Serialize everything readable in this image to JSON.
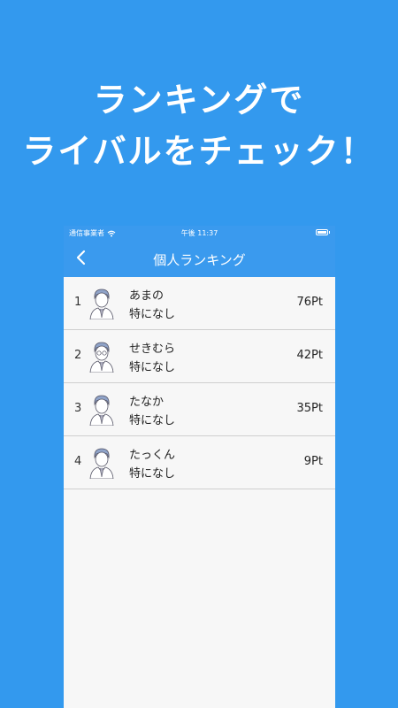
{
  "promo": {
    "line1": "ランキングで",
    "line2": "ライバルをチェック！"
  },
  "statusbar": {
    "carrier": "通信事業者",
    "time": "午後 11:37"
  },
  "navbar": {
    "title": "個人ランキング"
  },
  "rankings": [
    {
      "rank": "1",
      "name": "あまの",
      "status": "特になし",
      "points": "76Pt"
    },
    {
      "rank": "2",
      "name": "せきむら",
      "status": "特になし",
      "points": "42Pt"
    },
    {
      "rank": "3",
      "name": "たなか",
      "status": "特になし",
      "points": "35Pt"
    },
    {
      "rank": "4",
      "name": "たっくん",
      "status": "特になし",
      "points": "9Pt"
    }
  ],
  "colors": {
    "background": "#3399ee",
    "navbar": "#3a9aee",
    "list_bg": "#f7f7f7"
  },
  "icons": {
    "back": "chevron-left-icon",
    "wifi": "wifi-icon",
    "battery": "battery-icon",
    "avatar": "user-avatar-icon"
  }
}
